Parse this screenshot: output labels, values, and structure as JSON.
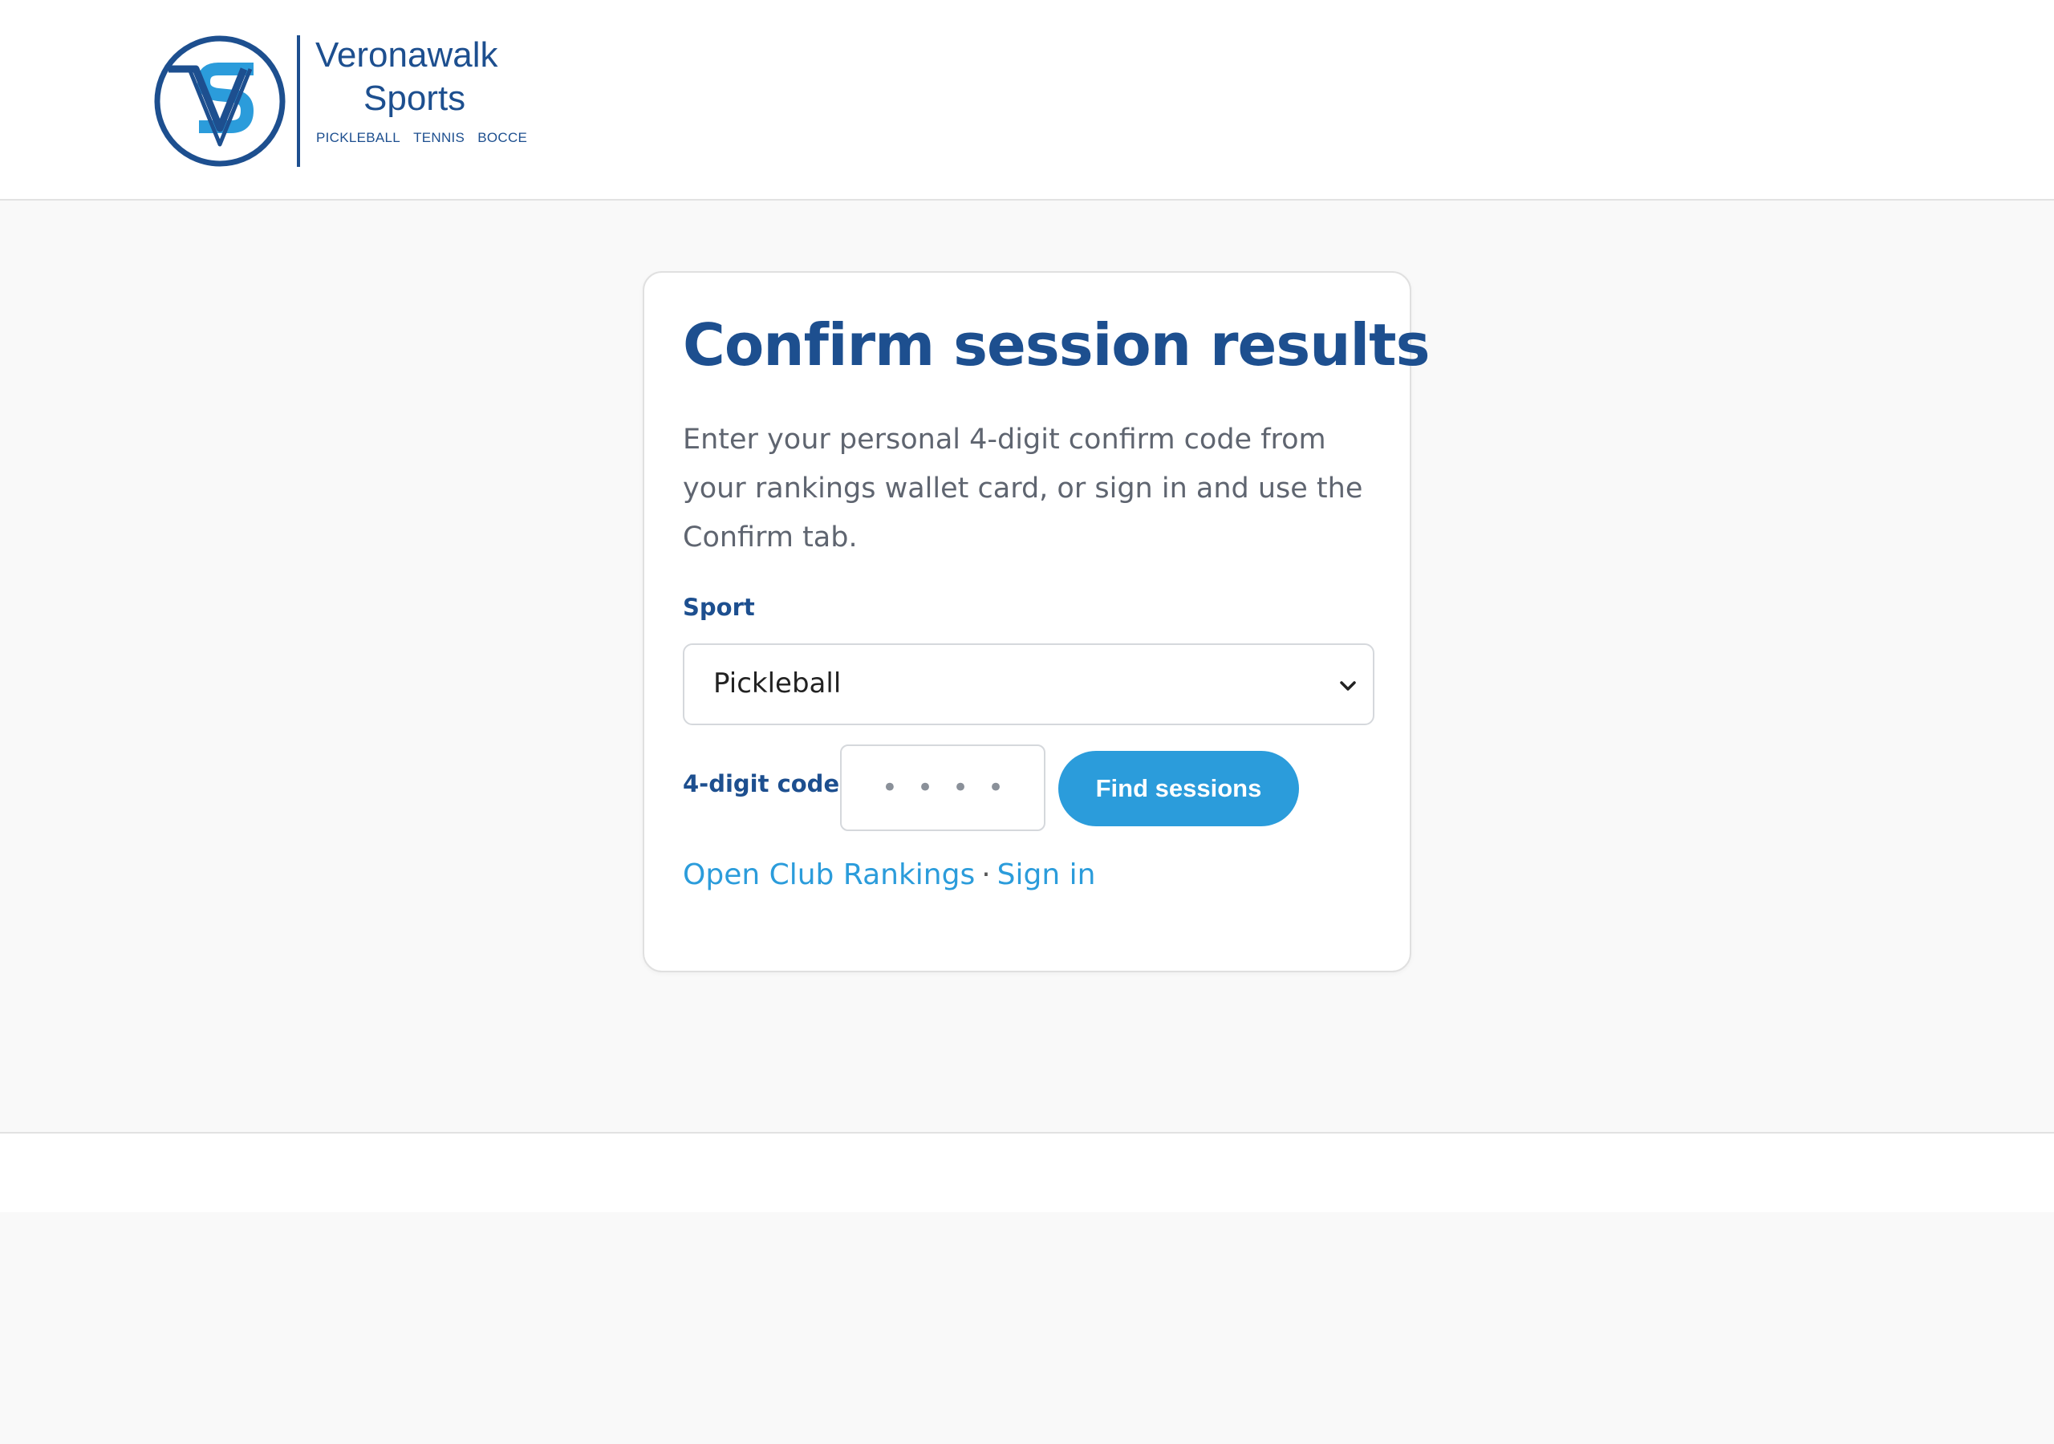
{
  "brand": {
    "logo_text": "VS",
    "name_line1": "Veronawalk",
    "name_line2": "Sports",
    "tags": [
      "PICKLEBALL",
      "TENNIS",
      "BOCCE"
    ]
  },
  "colors": {
    "primary": "#1d4f8f",
    "accent": "#2b9cdb",
    "text_muted": "#5f6570",
    "background": "#f9f9f9"
  },
  "card": {
    "title": "Confirm session results",
    "intro": "Enter your personal 4-digit confirm code from your rankings wallet card, or sign in and use the Confirm tab.",
    "sport_label": "Sport",
    "sport_value": "Pickleball",
    "code_label": "4-digit code",
    "code_placeholder": "••••",
    "find_button": "Find sessions",
    "link_rankings": "Open Club Rankings",
    "link_separator": "·",
    "link_signin": "Sign in"
  },
  "icons": {
    "select": "chevron-down-icon",
    "logo": "vs-monogram-logo"
  }
}
